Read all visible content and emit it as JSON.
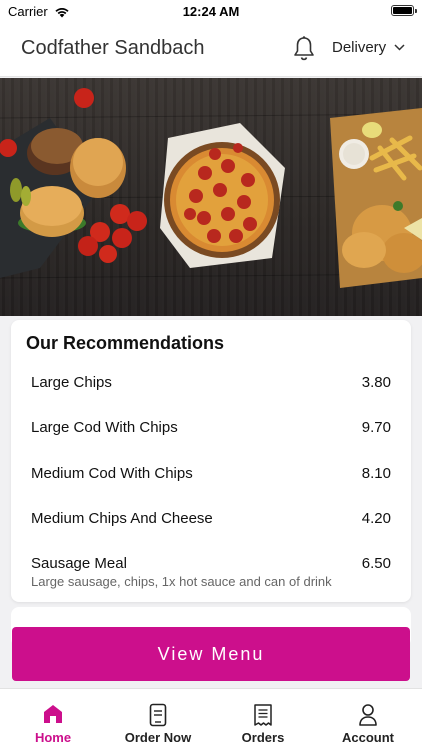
{
  "status_bar": {
    "carrier": "Carrier",
    "time": "12:24 AM",
    "battery_level": 1.0
  },
  "header": {
    "title": "Codfather Sandbach",
    "bell_icon": "bell-icon",
    "delivery_label": "Delivery",
    "delivery_icon": "chevron-down-icon"
  },
  "recommendations": {
    "title": "Our Recommendations",
    "items": [
      {
        "name": "Large Chips",
        "price": "3.80",
        "description": ""
      },
      {
        "name": "Large Cod With Chips",
        "price": "9.70",
        "description": ""
      },
      {
        "name": "Medium Cod With Chips",
        "price": "8.10",
        "description": ""
      },
      {
        "name": "Medium Chips And Cheese",
        "price": "4.20",
        "description": ""
      },
      {
        "name": "Sausage Meal",
        "price": "6.50",
        "description": "Large sausage, chips, 1x hot sauce and can of drink"
      }
    ]
  },
  "view_menu_label": "View Menu",
  "tabs": [
    {
      "label": "Home",
      "icon": "home-icon",
      "active": true
    },
    {
      "label": "Order Now",
      "icon": "order-icon",
      "active": false
    },
    {
      "label": "Orders",
      "icon": "receipt-icon",
      "active": false
    },
    {
      "label": "Account",
      "icon": "user-icon",
      "active": false
    }
  ],
  "colors": {
    "accent": "#cc0f8c",
    "background": "#f1f1f3",
    "card": "#ffffff"
  }
}
